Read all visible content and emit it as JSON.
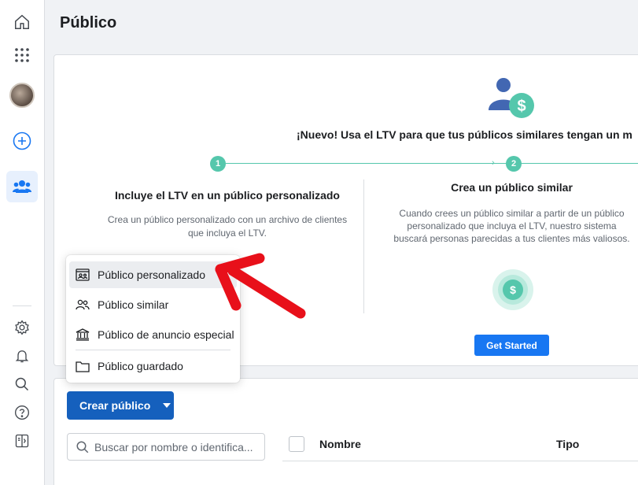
{
  "nav": {
    "items": [
      {
        "name": "home-icon"
      },
      {
        "name": "apps-grid-icon"
      },
      {
        "name": "avatar"
      },
      {
        "name": "add-icon"
      },
      {
        "name": "audiences-icon"
      },
      {
        "name": "settings-icon"
      },
      {
        "name": "notifications-icon"
      },
      {
        "name": "search-icon"
      },
      {
        "name": "help-icon"
      },
      {
        "name": "panel-toggle-icon"
      }
    ]
  },
  "page": {
    "title": "Público"
  },
  "promo": {
    "headline": "¡Nuevo! Usa el LTV para que tus públicos similares tengan un m",
    "step1": {
      "number": "1",
      "title": "Incluye el LTV en un público personalizado",
      "description": "Crea un público personalizado con un archivo de clientes que incluya el LTV."
    },
    "step2": {
      "number": "2",
      "title": "Crea un público similar",
      "description": "Cuando crees un público similar a partir de un público personalizado que incluya el LTV, nuestro sistema buscará personas parecidas a tus clientes más valiosos."
    },
    "get_started": "Get Started"
  },
  "menu": {
    "items": [
      {
        "label": "Público personalizado",
        "icon": "custom-audience-icon"
      },
      {
        "label": "Público similar",
        "icon": "lookalike-audience-icon"
      },
      {
        "label": "Público de anuncio especial",
        "icon": "special-ad-audience-icon"
      },
      {
        "label": "Público guardado",
        "icon": "folder-icon"
      }
    ]
  },
  "toolbar": {
    "create_label": "Crear público",
    "search_placeholder": "Buscar por nombre o identifica..."
  },
  "table": {
    "columns": [
      "Nombre",
      "Tipo"
    ]
  },
  "colors": {
    "accent": "#1877f2",
    "create_button": "#1560bd",
    "teal": "#55c7ac",
    "annotation_red": "#e8101a"
  }
}
